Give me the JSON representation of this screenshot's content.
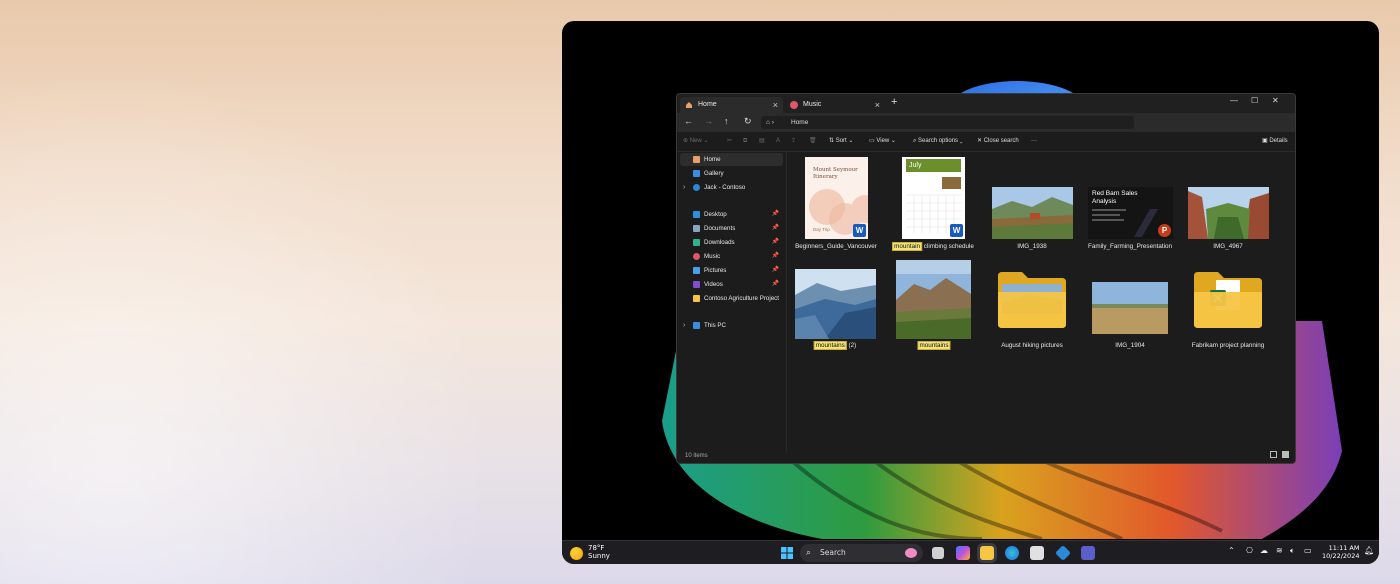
{
  "window": {
    "tabs": [
      {
        "label": "Home"
      },
      {
        "label": "Music"
      }
    ],
    "new_tab": "+",
    "controls": {
      "minimize": "—",
      "maximize": "☐",
      "close": "✕"
    },
    "address": {
      "segment": "Home"
    },
    "commands": {
      "new": "New",
      "sort": "Sort",
      "view": "View",
      "search_options": "Search options",
      "close_search": "Close search",
      "more": "···",
      "details": "Details"
    },
    "sidebar": [
      {
        "label": "Home",
        "icon": "home-icon",
        "selected": true
      },
      {
        "label": "Gallery",
        "icon": "gallery-icon"
      },
      {
        "label": "Jack - Contoso",
        "icon": "onedrive-icon",
        "expandable": true
      },
      {
        "label": "Desktop",
        "icon": "desktop-icon",
        "pinned": true
      },
      {
        "label": "Documents",
        "icon": "documents-icon",
        "pinned": true
      },
      {
        "label": "Downloads",
        "icon": "downloads-icon",
        "pinned": true
      },
      {
        "label": "Music",
        "icon": "music-icon",
        "pinned": true
      },
      {
        "label": "Pictures",
        "icon": "pictures-icon",
        "pinned": true
      },
      {
        "label": "Videos",
        "icon": "videos-icon",
        "pinned": true
      },
      {
        "label": "Contoso Agriculture Project",
        "icon": "folder-icon"
      },
      {
        "label": "This PC",
        "icon": "pc-icon",
        "expandable": true
      }
    ],
    "items": [
      {
        "name": "Beginners_Guide_Vancouver",
        "doc_title": "Mount Seymour Itinerary",
        "doc_sub": "Day Trip",
        "badge": "W"
      },
      {
        "name_hl": "mountain",
        "name_rest": " climbing schedule",
        "doc_title": "July",
        "badge": "W"
      },
      {
        "name": "IMG_1938"
      },
      {
        "name": "Family_Farming_Presentation",
        "doc_title": "Red Barn Sales Analysis",
        "badge": "P"
      },
      {
        "name": "IMG_4967"
      },
      {
        "name_hl": "mountains",
        "name_rest": " (2)"
      },
      {
        "name_hl": "mountains",
        "name_rest": ""
      },
      {
        "name": "August hiking pictures"
      },
      {
        "name": "IMG_1904"
      },
      {
        "name": "Fabrikam project planning"
      }
    ],
    "status": "10 items"
  },
  "taskbar": {
    "weather": {
      "temp": "78°F",
      "condition": "Sunny"
    },
    "search": "Search",
    "time": "11:11 AM",
    "date": "10/22/2024"
  },
  "colors": {
    "accent": "#2b88d8",
    "highlight": "#f4e37a",
    "word": "#185abd",
    "powerpoint": "#c43e1c",
    "excel": "#1d6f42",
    "folder": "#f6c544"
  }
}
